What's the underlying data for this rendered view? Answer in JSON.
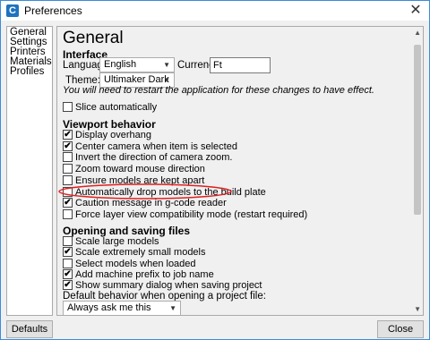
{
  "window": {
    "title": "Preferences",
    "app_icon": "C"
  },
  "sidebar": {
    "items": [
      {
        "label": "General"
      },
      {
        "label": "Settings"
      },
      {
        "label": "Printers"
      },
      {
        "label": "Materials"
      },
      {
        "label": "Profiles"
      }
    ]
  },
  "general": {
    "title": "General",
    "interface": {
      "heading": "Interface",
      "language_label": "Language:",
      "language_value": "English",
      "currency_label": "Currency:",
      "currency_value": "Ft",
      "theme_label": "Theme:",
      "theme_value": "Ultimaker Dark",
      "restart_note": "You will need to restart the application for these changes to have effect.",
      "slice_auto": {
        "label": "Slice automatically",
        "checked": false
      }
    },
    "viewport": {
      "heading": "Viewport behavior",
      "options": [
        {
          "label": "Display overhang",
          "checked": true
        },
        {
          "label": "Center camera when item is selected",
          "checked": true
        },
        {
          "label": "Invert the direction of camera zoom.",
          "checked": false
        },
        {
          "label": "Zoom toward mouse direction",
          "checked": false
        },
        {
          "label": "Ensure models are kept apart",
          "checked": false
        },
        {
          "label": "Automatically drop models to the build plate",
          "checked": false
        },
        {
          "label": "Caution message in g-code reader",
          "checked": true
        },
        {
          "label": "Force layer view compatibility mode (restart required)",
          "checked": false
        }
      ]
    },
    "opening": {
      "heading": "Opening and saving files",
      "options": [
        {
          "label": "Scale large models",
          "checked": false
        },
        {
          "label": "Scale extremely small models",
          "checked": true
        },
        {
          "label": "Select models when loaded",
          "checked": false
        },
        {
          "label": "Add machine prefix to job name",
          "checked": true
        },
        {
          "label": "Show summary dialog when saving project",
          "checked": true
        }
      ],
      "default_behavior_label": "Default behavior when opening a project file:",
      "default_behavior_value": "Always ask me this"
    }
  },
  "footer": {
    "defaults_label": "Defaults",
    "close_label": "Close"
  },
  "colors": {
    "accent": "#3c8bd9",
    "highlight_circle": "#e02020"
  }
}
